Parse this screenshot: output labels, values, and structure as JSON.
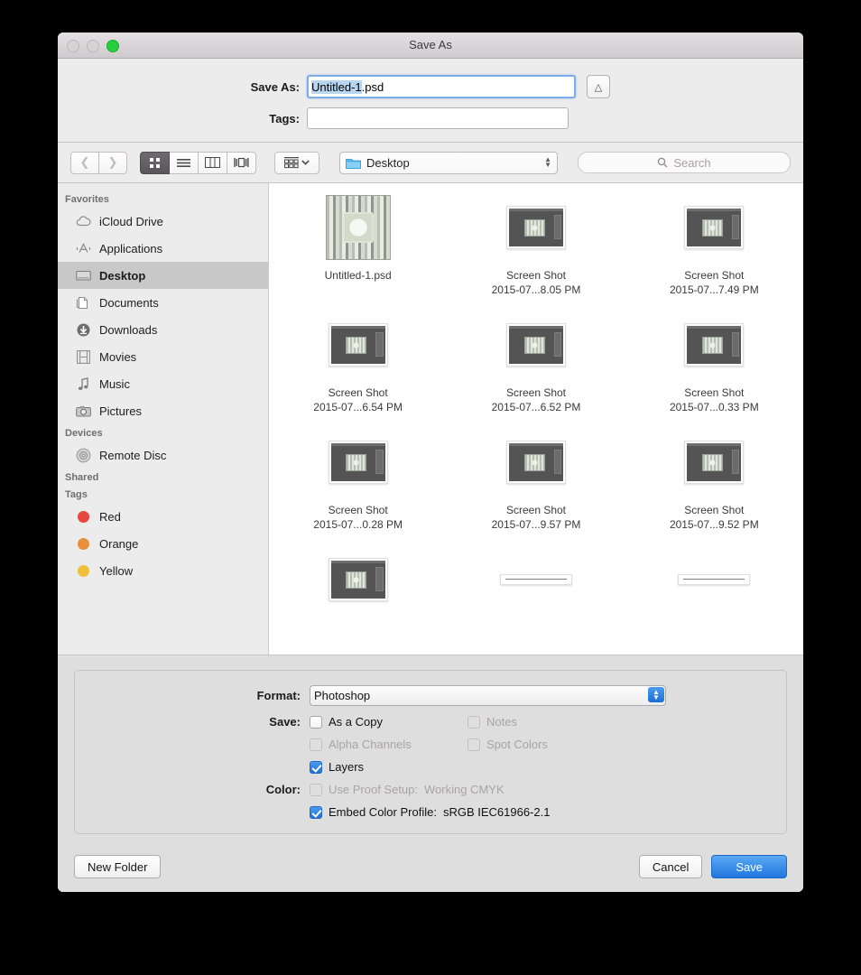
{
  "window": {
    "title": "Save As",
    "traffic_lights": [
      {
        "name": "close",
        "state": "disabled"
      },
      {
        "name": "minimize",
        "state": "disabled"
      },
      {
        "name": "zoom",
        "state": "enabled",
        "color": "#28cc3f"
      }
    ]
  },
  "name_fields": {
    "save_as_label": "Save As:",
    "save_as_value_selected": "Untitled-1",
    "save_as_value_rest": ".psd",
    "tags_label": "Tags:",
    "tags_value": "",
    "disclosure_icon": "chevron-up-icon"
  },
  "toolbar": {
    "back_icon": "chevron-left-icon",
    "forward_icon": "chevron-right-icon",
    "views": [
      {
        "name": "icon-view",
        "icon": "grid-icon",
        "selected": true
      },
      {
        "name": "list-view",
        "icon": "list-icon",
        "selected": false
      },
      {
        "name": "column-view",
        "icon": "columns-icon",
        "selected": false
      },
      {
        "name": "coverflow-view",
        "icon": "coverflow-icon",
        "selected": false
      }
    ],
    "arrange_icon": "arrange-grid-icon",
    "arrange_chevron": "chevron-down-icon",
    "path_label": "Desktop",
    "path_icon": "folder-icon",
    "search_placeholder": "Search",
    "search_icon": "search-icon"
  },
  "sidebar": {
    "sections": [
      {
        "header": "Favorites",
        "items": [
          {
            "label": "iCloud Drive",
            "icon": "cloud-icon",
            "selected": false
          },
          {
            "label": "Applications",
            "icon": "applications-icon",
            "selected": false
          },
          {
            "label": "Desktop",
            "icon": "desktop-icon",
            "selected": true
          },
          {
            "label": "Documents",
            "icon": "documents-icon",
            "selected": false
          },
          {
            "label": "Downloads",
            "icon": "download-icon",
            "selected": false
          },
          {
            "label": "Movies",
            "icon": "film-icon",
            "selected": false
          },
          {
            "label": "Music",
            "icon": "music-note-icon",
            "selected": false
          },
          {
            "label": "Pictures",
            "icon": "camera-icon",
            "selected": false
          }
        ]
      },
      {
        "header": "Devices",
        "items": [
          {
            "label": "Remote Disc",
            "icon": "disc-icon",
            "selected": false
          }
        ]
      },
      {
        "header": "Shared",
        "items": []
      },
      {
        "header": "Tags",
        "items": [
          {
            "label": "Red",
            "icon": "tag-dot-icon",
            "color": "#e8483f",
            "selected": false
          },
          {
            "label": "Orange",
            "icon": "tag-dot-icon",
            "color": "#e8913a",
            "selected": false
          },
          {
            "label": "Yellow",
            "icon": "tag-dot-icon",
            "color": "#efc13a",
            "selected": false
          }
        ]
      }
    ]
  },
  "files": [
    {
      "name_line1": "Untitled-1.psd",
      "name_line2": "",
      "thumb": "psd"
    },
    {
      "name_line1": "Screen Shot",
      "name_line2": "2015-07...8.05 PM",
      "thumb": "screenshot"
    },
    {
      "name_line1": "Screen Shot",
      "name_line2": "2015-07...7.49 PM",
      "thumb": "screenshot"
    },
    {
      "name_line1": "Screen Shot",
      "name_line2": "2015-07...6.54 PM",
      "thumb": "screenshot"
    },
    {
      "name_line1": "Screen Shot",
      "name_line2": "2015-07...6.52 PM",
      "thumb": "screenshot"
    },
    {
      "name_line1": "Screen Shot",
      "name_line2": "2015-07...0.33 PM",
      "thumb": "screenshot"
    },
    {
      "name_line1": "Screen Shot",
      "name_line2": "2015-07...0.28 PM",
      "thumb": "screenshot"
    },
    {
      "name_line1": "Screen Shot",
      "name_line2": "2015-07...9.57 PM",
      "thumb": "screenshot"
    },
    {
      "name_line1": "Screen Shot",
      "name_line2": "2015-07...9.52 PM",
      "thumb": "screenshot"
    },
    {
      "name_line1": "",
      "name_line2": "",
      "thumb": "screenshot"
    },
    {
      "name_line1": "",
      "name_line2": "",
      "thumb": "wide"
    },
    {
      "name_line1": "",
      "name_line2": "",
      "thumb": "wide"
    }
  ],
  "options": {
    "format_label": "Format:",
    "format_value": "Photoshop",
    "save_label": "Save:",
    "color_label": "Color:",
    "checkboxes": {
      "as_a_copy": {
        "label": "As a Copy",
        "checked": false,
        "enabled": true
      },
      "notes": {
        "label": "Notes",
        "checked": false,
        "enabled": false
      },
      "alpha_channels": {
        "label": "Alpha Channels",
        "checked": false,
        "enabled": false
      },
      "spot_colors": {
        "label": "Spot Colors",
        "checked": false,
        "enabled": false
      },
      "layers": {
        "label": "Layers",
        "checked": true,
        "enabled": true
      },
      "use_proof_setup": {
        "label": "Use Proof Setup:",
        "value": "Working CMYK",
        "checked": false,
        "enabled": false
      },
      "embed_color_profile": {
        "label": "Embed Color Profile:",
        "value": "sRGB IEC61966-2.1",
        "checked": true,
        "enabled": true
      }
    }
  },
  "footer": {
    "new_folder_label": "New Folder",
    "cancel_label": "Cancel",
    "save_label": "Save",
    "accent_color": "#2076de"
  }
}
